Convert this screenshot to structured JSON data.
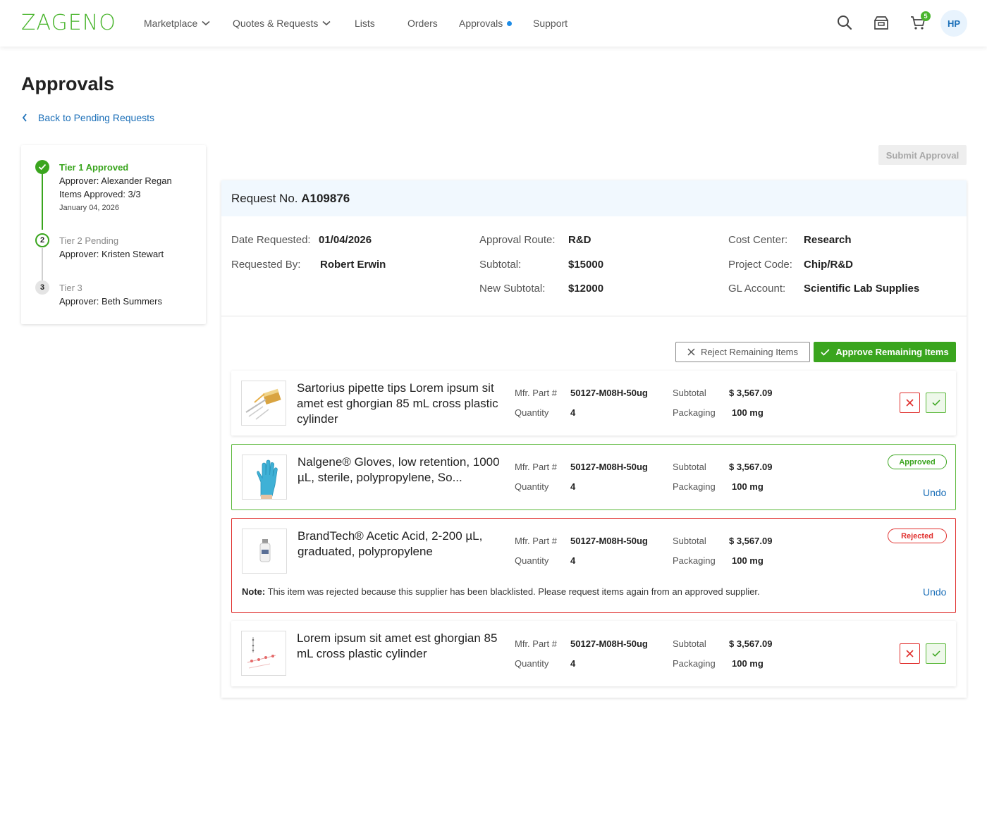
{
  "header": {
    "logo": "ZAGENO",
    "nav": [
      {
        "label": "Marketplace"
      },
      {
        "label": "Quotes & Requests"
      },
      {
        "label": "Lists"
      },
      {
        "label": "Orders"
      },
      {
        "label": "Approvals"
      },
      {
        "label": "Support"
      }
    ],
    "cart_count": "5",
    "avatar_initials": "HP"
  },
  "page": {
    "title": "Approvals",
    "back_link": "Back to Pending Requests",
    "submit_label": "Submit Approval"
  },
  "tiers": [
    {
      "title": "Tier 1 Approved",
      "approver": "Approver: Alexander Regan",
      "items": "Items Approved: 3/3",
      "date": "January 04, 2026",
      "dot": ""
    },
    {
      "title": "Tier 2 Pending",
      "approver": "Approver: Kristen Stewart",
      "dot": "2"
    },
    {
      "title": "Tier 3",
      "approver": "Approver: Beth Summers",
      "dot": "3"
    }
  ],
  "request": {
    "prefix": "Request No.",
    "number": "A109876",
    "fields": {
      "date_requested_label": "Date Requested:",
      "date_requested": "01/04/2026",
      "requested_by_label": "Requested By:",
      "requested_by": "Robert Erwin",
      "approval_route_label": "Approval Route:",
      "approval_route": "R&D",
      "subtotal_label": "Subtotal:",
      "subtotal": "$15000",
      "new_subtotal_label": "New Subtotal:",
      "new_subtotal": "$12000",
      "cost_center_label": "Cost Center:",
      "cost_center": "Research",
      "project_code_label": "Project Code:",
      "project_code": "Chip/R&D",
      "gl_account_label": "GL Account:",
      "gl_account": "Scientific Lab Supplies"
    },
    "reject_all_label": "Reject Remaining Items",
    "approve_all_label": "Approve Remaining Items"
  },
  "labels": {
    "mfr": "Mfr. Part #",
    "quantity": "Quantity",
    "subtotal": "Subtotal",
    "packaging": "Packaging",
    "approved_badge": "Approved",
    "rejected_badge": "Rejected",
    "undo": "Undo",
    "note_label": "Note:"
  },
  "items": [
    {
      "name": "Sartorius pipette tips Lorem ipsum sit amet est ghorgian 85 mL cross plastic cylinder",
      "mfr": "50127-M08H-50ug",
      "quantity": "4",
      "subtotal": "$ 3,567.09",
      "packaging": "100 mg",
      "status": "pending"
    },
    {
      "name": "Nalgene® Gloves, low retention, 1000 µL, sterile, polypropylene, So...",
      "mfr": "50127-M08H-50ug",
      "quantity": "4",
      "subtotal": "$ 3,567.09",
      "packaging": "100 mg",
      "status": "approved"
    },
    {
      "name": "BrandTech®  Acetic Acid, 2-200 µL, graduated, polypropylene",
      "mfr": "50127-M08H-50ug",
      "quantity": "4",
      "subtotal": "$ 3,567.09",
      "packaging": "100 mg",
      "status": "rejected",
      "note": "This item was rejected because this supplier has been blacklisted. Please request items again from an approved supplier."
    },
    {
      "name": "Lorem ipsum sit amet est ghorgian 85 mL cross plastic cylinder",
      "mfr": "50127-M08H-50ug",
      "quantity": "4",
      "subtotal": "$ 3,567.09",
      "packaging": "100 mg",
      "status": "pending"
    }
  ],
  "colors": {
    "brand_green": "#4ab52e",
    "link_blue": "#1b6fb8",
    "reject_red": "#e0302e"
  }
}
